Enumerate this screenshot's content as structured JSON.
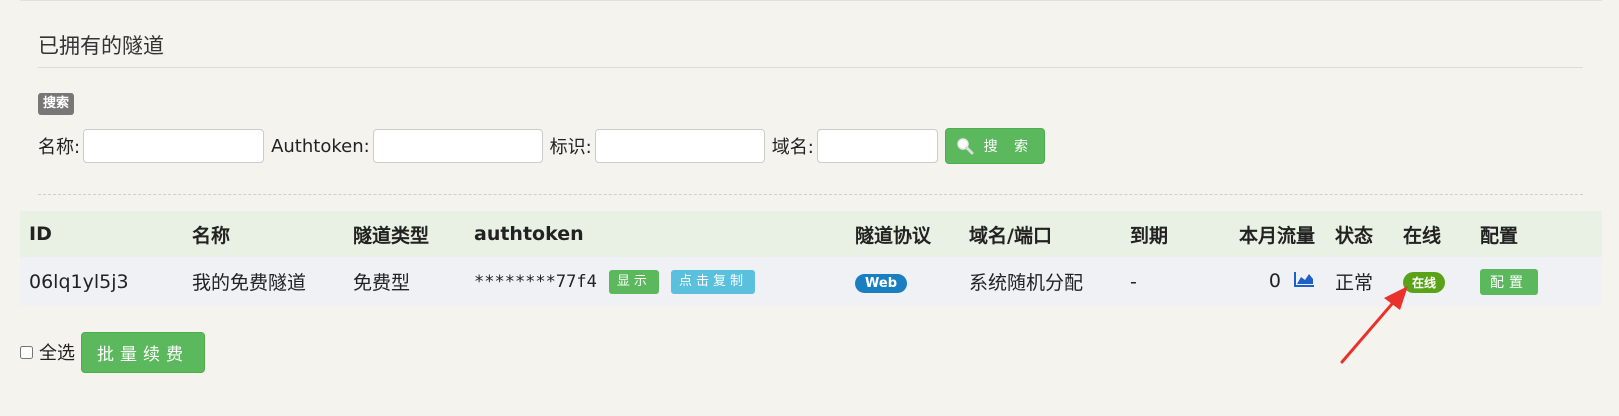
{
  "section": {
    "title": "已拥有的隧道"
  },
  "search": {
    "badge": "搜索",
    "name_label": "名称:",
    "authtoken_label": "Authtoken:",
    "tag_label": "标识:",
    "domain_label": "域名:",
    "button_label": "搜 索",
    "icon": "search-icon"
  },
  "table": {
    "headers": [
      "ID",
      "名称",
      "隧道类型",
      "authtoken",
      "隧道协议",
      "域名/端口",
      "到期",
      "本月流量",
      "状态",
      "在线",
      "配置"
    ],
    "rows": [
      {
        "id": "06lq1yl5j3",
        "name": "我的免费隧道",
        "type": "免费型",
        "authtoken": "********77f4",
        "show_label": "显示",
        "copy_label": "点击复制",
        "protocol": "Web",
        "domain": "系统随机分配",
        "expire": "-",
        "traffic": "0",
        "traffic_icon": "area-chart-icon",
        "status": "正常",
        "online": "在线",
        "config_label": "配置"
      }
    ]
  },
  "bottom": {
    "select_all_label": "全选",
    "renew_label": "批量续费"
  },
  "colors": {
    "primary_green": "#5cb85c",
    "info_blue": "#5bc0de",
    "web_badge": "#1a7fc1",
    "online_badge": "#5aa319",
    "annotation_arrow": "#e8322b"
  }
}
